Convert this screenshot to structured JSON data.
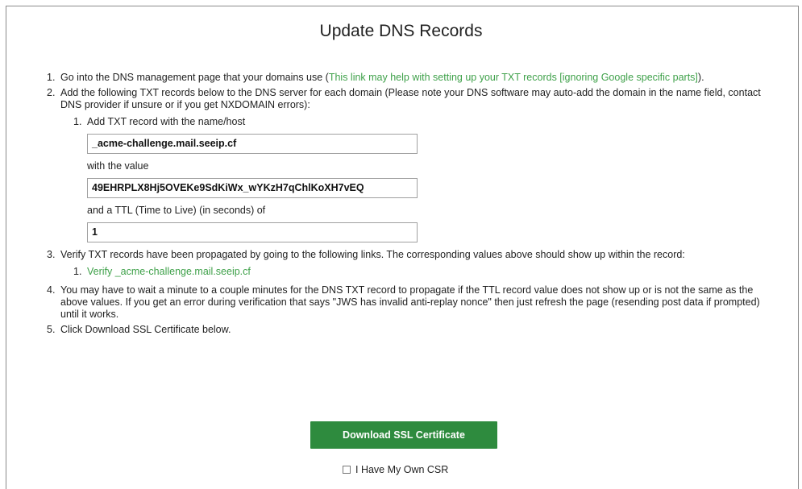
{
  "page": {
    "title": "Update DNS Records"
  },
  "steps": {
    "s1": {
      "num": "1.",
      "text": "Go into the DNS management page that your domains use (",
      "link": "This link may help with setting up your TXT records [ignoring Google specific parts]",
      "suffix": ")."
    },
    "s2": {
      "num": "2.",
      "text": "Add the following TXT records below to the DNS server for each domain (Please note your DNS software may auto-add the domain in the name field, contact DNS provider if unsure or if you get NXDOMAIN errors):",
      "record": {
        "num": "1.",
        "name_label": "Add TXT record with the name/host",
        "name_value": "_acme-challenge.mail.seeip.cf",
        "value_label": "with the value",
        "value_value": "49EHRPLX8Hj5OVEKe9SdKiWx_wYKzH7qChlKoXH7vEQ",
        "ttl_label": "and a TTL (Time to Live) (in seconds) of",
        "ttl_value": "1"
      }
    },
    "s3": {
      "num": "3.",
      "text": "Verify TXT records have been propagated by going to the following links. The corresponding values above should show up within the record:",
      "link_num": "1.",
      "link": "Verify _acme-challenge.mail.seeip.cf"
    },
    "s4": {
      "num": "4.",
      "text": "You may have to wait a minute to a couple minutes for the DNS TXT record to propagate if the TTL record value does not show up or is not the same as the above values. If you get an error during verification that says \"JWS has invalid anti-replay nonce\" then just refresh the page (resending post data if prompted) until it works."
    },
    "s5": {
      "num": "5.",
      "text": "Click Download SSL Certificate below."
    }
  },
  "actions": {
    "download_label": "Download SSL Certificate",
    "csr_label": "I Have My Own CSR",
    "csr_checked": false
  },
  "colors": {
    "link": "#3fa14a",
    "button": "#2e8b3e"
  }
}
